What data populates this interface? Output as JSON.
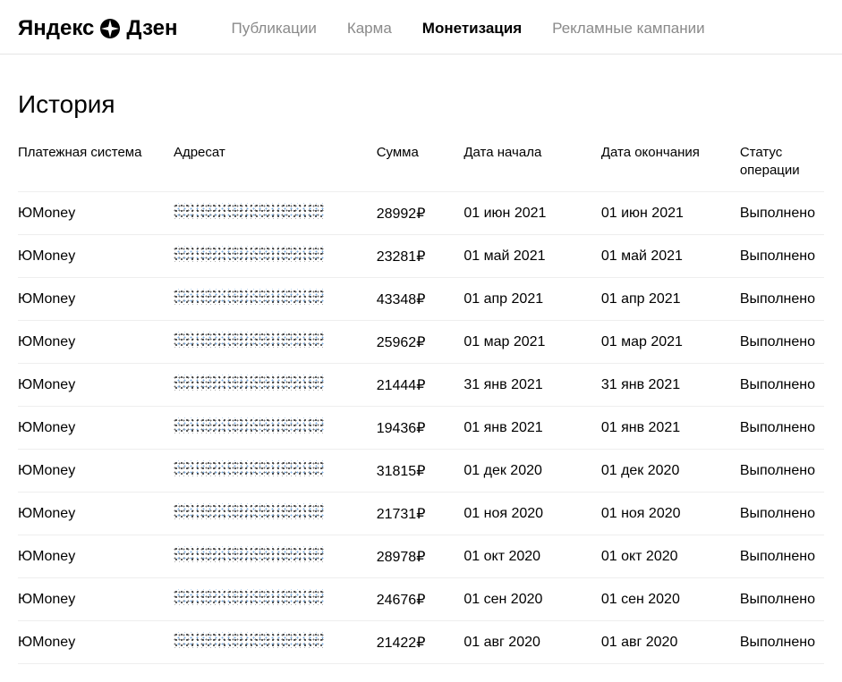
{
  "logo": {
    "part1": "Яндекс",
    "part2": "Дзен"
  },
  "nav": {
    "items": [
      "Публикации",
      "Карма",
      "Монетизация",
      "Рекламные кампании"
    ],
    "activeIndex": 2
  },
  "page": {
    "title": "История"
  },
  "table": {
    "headers": {
      "ps": "Платежная система",
      "addr": "Адресат",
      "sum": "Сумма",
      "start": "Дата начала",
      "end": "Дата окончания",
      "status": "Статус операции"
    },
    "rows": [
      {
        "ps": "ЮMoney",
        "sum": "28992",
        "start": "01 июн 2021",
        "end": "01 июн 2021",
        "status": "Выполнено"
      },
      {
        "ps": "ЮMoney",
        "sum": "23281",
        "start": "01 май 2021",
        "end": "01 май 2021",
        "status": "Выполнено"
      },
      {
        "ps": "ЮMoney",
        "sum": "43348",
        "start": "01 апр 2021",
        "end": "01 апр 2021",
        "status": "Выполнено"
      },
      {
        "ps": "ЮMoney",
        "sum": "25962",
        "start": "01 мар 2021",
        "end": "01 мар 2021",
        "status": "Выполнено"
      },
      {
        "ps": "ЮMoney",
        "sum": "21444",
        "start": "31 янв 2021",
        "end": "31 янв 2021",
        "status": "Выполнено"
      },
      {
        "ps": "ЮMoney",
        "sum": "19436",
        "start": "01 янв 2021",
        "end": "01 янв 2021",
        "status": "Выполнено"
      },
      {
        "ps": "ЮMoney",
        "sum": "31815",
        "start": "01 дек 2020",
        "end": "01 дек 2020",
        "status": "Выполнено"
      },
      {
        "ps": "ЮMoney",
        "sum": "21731",
        "start": "01 ноя 2020",
        "end": "01 ноя 2020",
        "status": "Выполнено"
      },
      {
        "ps": "ЮMoney",
        "sum": "28978",
        "start": "01 окт 2020",
        "end": "01 окт 2020",
        "status": "Выполнено"
      },
      {
        "ps": "ЮMoney",
        "sum": "24676",
        "start": "01 сен 2020",
        "end": "01 сен 2020",
        "status": "Выполнено"
      },
      {
        "ps": "ЮMoney",
        "sum": "21422",
        "start": "01 авг 2020",
        "end": "01 авг 2020",
        "status": "Выполнено"
      }
    ]
  }
}
